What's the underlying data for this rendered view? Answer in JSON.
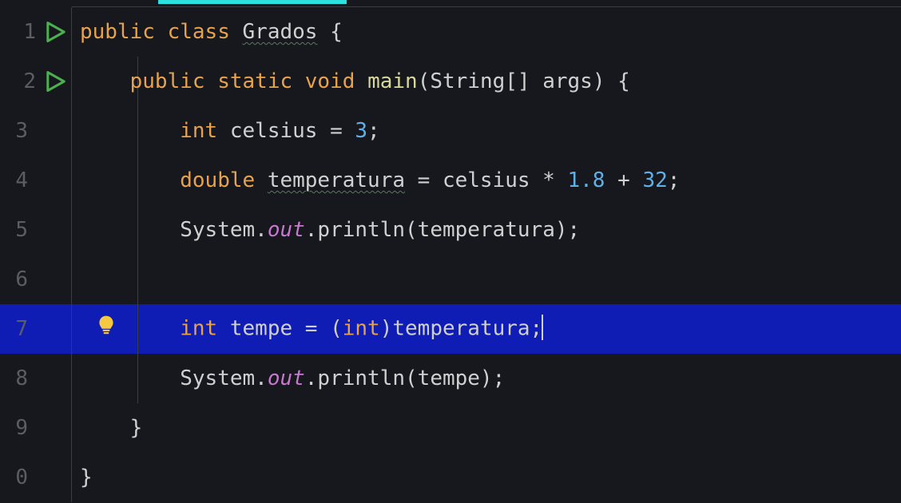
{
  "lines": {
    "num1": "1",
    "num2": "2",
    "num3": "3",
    "num4": "4",
    "num5": "5",
    "num6": "6",
    "num7": "7",
    "num8": "8",
    "num9": "9",
    "num10": "0"
  },
  "code": {
    "l1": {
      "kw1": "public",
      "kw2": "class",
      "name": "Grados",
      "brace": " {"
    },
    "l2": {
      "kw1": "public",
      "kw2": "static",
      "kw3": "void",
      "fn": "main",
      "params": "(String[] args) {"
    },
    "l3": {
      "kw": "int",
      "text1": " celsius = ",
      "num": "3",
      "semi": ";"
    },
    "l4": {
      "kw": "double",
      "sp": " ",
      "var": "temperatura",
      "text1": " = celsius * ",
      "num1": "1.8",
      "text2": " + ",
      "num2": "32",
      "semi": ";"
    },
    "l5": {
      "text1": "System.",
      "out": "out",
      "text2": ".println(temperatura);"
    },
    "l7": {
      "kw1": "int",
      "text1": " tempe = (",
      "kw2": "int",
      "text2": ")temperatura;"
    },
    "l8": {
      "text1": "System.",
      "out": "out",
      "text2": ".println(tempe);"
    },
    "l9": {
      "brace": "}"
    },
    "l10": {
      "brace": "}"
    }
  }
}
